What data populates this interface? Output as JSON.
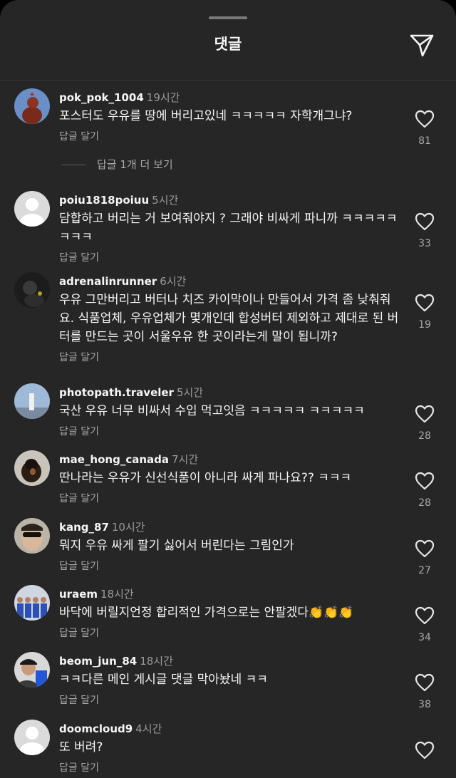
{
  "header": {
    "title": "댓글"
  },
  "comments": [
    {
      "username": "pok_pok_1004",
      "time": "19시간",
      "text": "포스터도 우유를 땅에 버리고있네 ㅋㅋㅋㅋㅋ 자학개그냐?",
      "reply": "답글 달기",
      "likes": "81",
      "avatar": "photo-rooster"
    },
    {
      "username": "poiu1818poiuu",
      "time": "5시간",
      "text": "담합하고 버리는 거 보여줘야지 ? 그래야 비싸게 파니까 ㅋㅋㅋㅋㅋㅋㅋㅋ",
      "reply": "답글 달기",
      "likes": "33",
      "avatar": "default"
    },
    {
      "username": "adrenalinrunner",
      "time": "6시간",
      "text": "우유 그만버리고 버터나 치즈 카이막이나 만들어서 가격 좀 낮춰줘요. 식품업체, 우유업체가 몇개인데 합성버터 제외하고 제대로 된 버터를 만드는 곳이 서울우유 한 곳이라는게 말이 됩니까?",
      "reply": "답글 달기",
      "likes": "19",
      "avatar": "photo-dark"
    },
    {
      "username": "photopath.traveler",
      "time": "5시간",
      "text": "국산 우유 너무 비싸서 수입 먹고잇음 ㅋㅋㅋㅋㅋ ㅋㅋㅋㅋㅋ",
      "reply": "답글 달기",
      "likes": "28",
      "avatar": "photo-sky"
    },
    {
      "username": "mae_hong_canada",
      "time": "7시간",
      "text": "딴나라는 우유가 신선식품이 아니라 싸게 파나요?? ㅋㅋㅋ",
      "reply": "답글 달기",
      "likes": "28",
      "avatar": "photo-dog"
    },
    {
      "username": "kang_87",
      "time": "10시간",
      "text": "뭐지 우유 싸게 팔기 싫어서 버린다는 그림인가",
      "reply": "답글 달기",
      "likes": "27",
      "avatar": "photo-face"
    },
    {
      "username": "uraem",
      "time": "18시간",
      "text": "바닥에 버릴지언정 합리적인 가격으로는 안팔겠다👏👏👏",
      "reply": "답글 달기",
      "likes": "34",
      "avatar": "photo-team"
    },
    {
      "username": "beom_jun_84",
      "time": "18시간",
      "text": "ㅋㅋ다른 메인 게시글 댓글 막아놨네 ㅋㅋ",
      "reply": "답글 달기",
      "likes": "38",
      "avatar": "photo-person"
    },
    {
      "username": "doomcloud9",
      "time": "4시간",
      "text": "또 버려?",
      "reply": "답글 달기",
      "likes": "",
      "avatar": "default"
    }
  ],
  "more_replies": "답글 1개 더 보기"
}
